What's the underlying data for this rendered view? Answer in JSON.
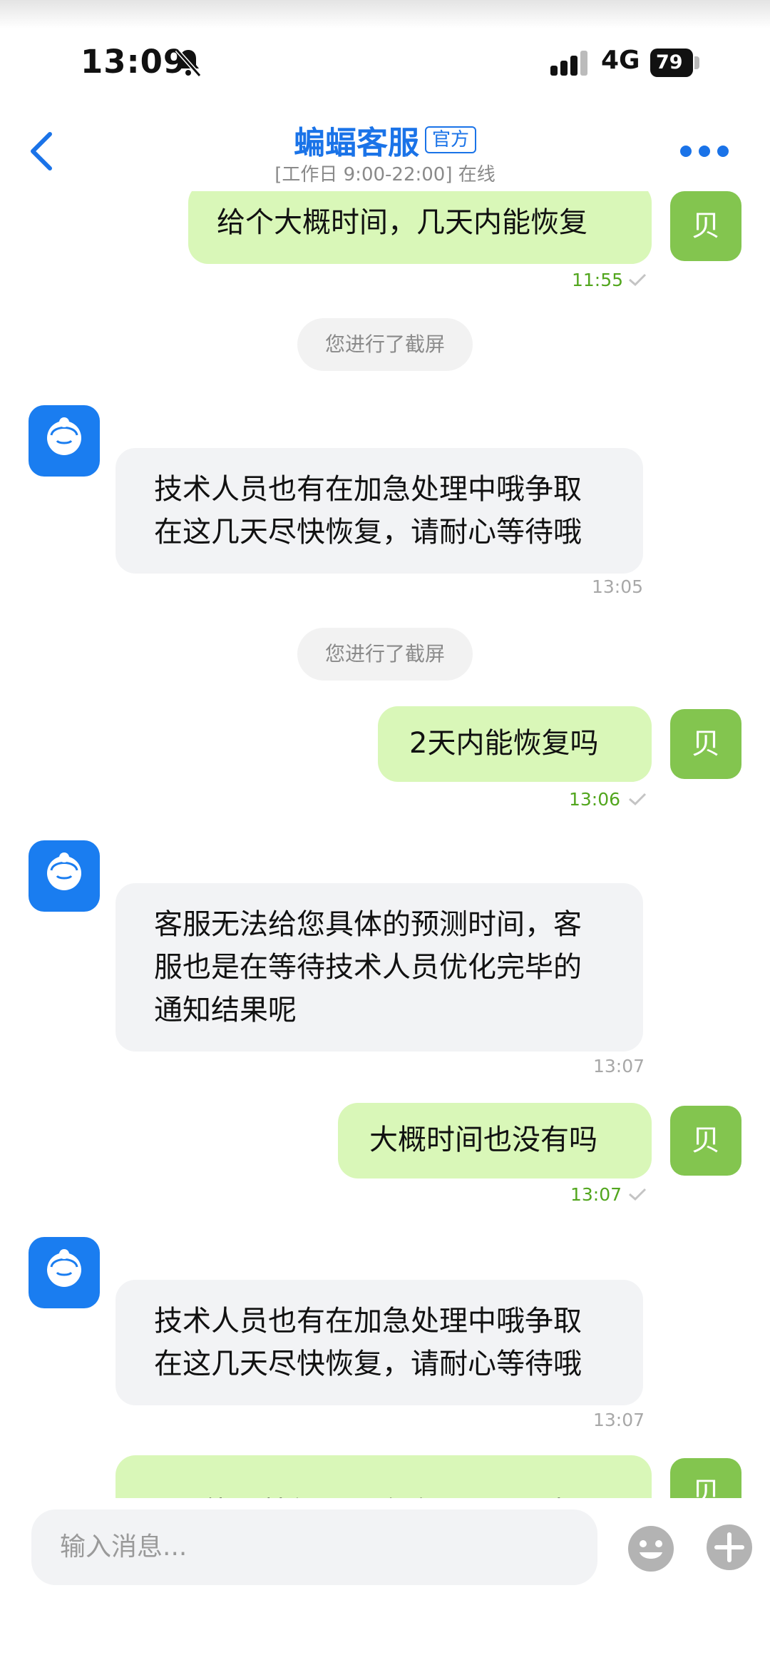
{
  "status_bar": {
    "time": "13:09",
    "network": "4G",
    "battery": "79"
  },
  "header": {
    "title": "蝙蝠客服",
    "badge": "官方",
    "subtitle": "[工作日 9:00-22:00] 在线",
    "back_icon": "chevron-left-icon",
    "more_icon": "more-dots-icon"
  },
  "me_avatar_label": "贝",
  "messages": [
    {
      "sender": "me",
      "lines": [
        "给个大概时间，几天内能恢复"
      ],
      "time": "11:55"
    },
    {
      "sender": "system",
      "text": "您进行了截屏"
    },
    {
      "sender": "cs",
      "lines": [
        "技术人员也有在加急处理中哦争取",
        "在这几天尽快恢复，请耐心等待哦"
      ],
      "time": "13:05"
    },
    {
      "sender": "system",
      "text": "您进行了截屏"
    },
    {
      "sender": "me",
      "lines": [
        "2天内能恢复吗"
      ],
      "time": "13:06"
    },
    {
      "sender": "cs",
      "lines": [
        "客服无法给您具体的预测时间，客",
        "服也是在等待技术人员优化完毕的",
        "通知结果呢"
      ],
      "time": "13:07"
    },
    {
      "sender": "me",
      "lines": [
        "大概时间也没有吗"
      ],
      "time": "13:07"
    },
    {
      "sender": "cs",
      "lines": [
        "技术人员也有在加急处理中哦争取",
        "在这几天尽快恢复，请耐心等待哦"
      ],
      "time": "13:07"
    },
    {
      "sender": "me",
      "lines": [
        "只要能用就行，别跑路了😂网上都"
      ]
    }
  ],
  "input": {
    "placeholder": "输入消息..."
  },
  "colors": {
    "accent": "#1a73e8",
    "outgoing_bubble": "#d9f7b8",
    "incoming_bubble": "#f2f3f5",
    "me_avatar": "#83c54f",
    "cs_avatar": "#1a7df0"
  }
}
